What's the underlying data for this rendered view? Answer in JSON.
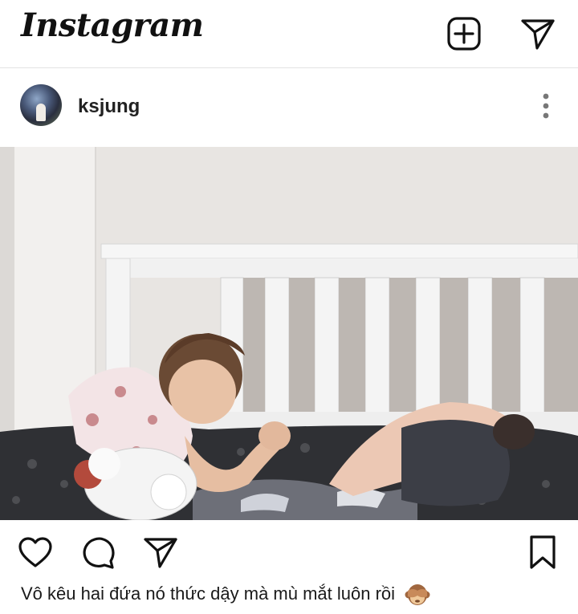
{
  "app": {
    "logo": "Instagram"
  },
  "topbar": {
    "icons": [
      "new-post-icon",
      "direct-message-icon"
    ]
  },
  "post": {
    "username": "ksjung",
    "caption": "Vô kêu hai đứa nó thức dậy mà mù mắt luôn rồi",
    "caption_emoji": "🙈",
    "actions": [
      "like-icon",
      "comment-icon",
      "share-icon",
      "save-icon"
    ]
  },
  "colors": {
    "text": "#111111",
    "background": "#ffffff",
    "divider": "#e3e3e3"
  }
}
